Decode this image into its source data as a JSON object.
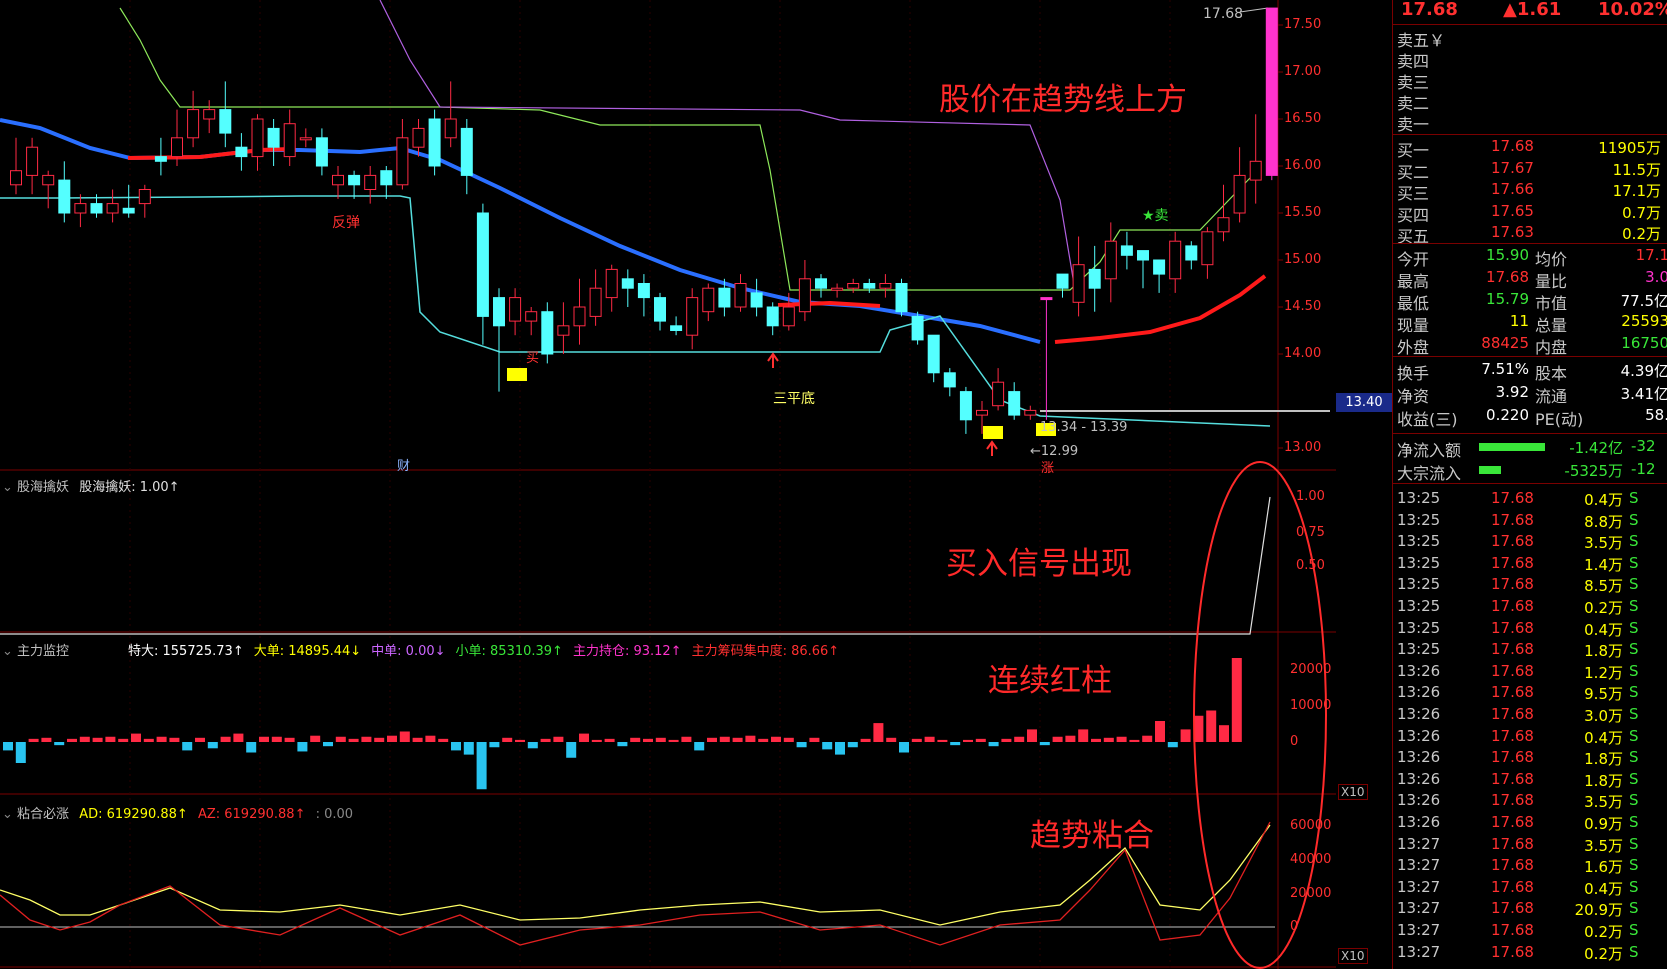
{
  "colors": {
    "up": "#ff2a44",
    "down": "#54ffff",
    "ma_blue": "#2a6fff",
    "ma_red": "#ff1a1a",
    "magenta": "#ff33cc",
    "yellow": "#ffff00",
    "green": "#39e639",
    "grid": "#7a0000"
  },
  "annotations": {
    "above_trend": "股价在趋势线上方",
    "buy_signal": "买入信号出现",
    "red_bars": "连续红柱",
    "trend_merge": "趋势粘合"
  },
  "main_panel": {
    "high_price": "17.68",
    "price_label_40": "13.40",
    "low_price": "←12.99",
    "range_label": "13.34 - 13.39",
    "label_rebound": "反弹",
    "label_three_bottom": "三平底",
    "label_sell": "★卖",
    "label_finance": "财",
    "label_rise": "涨",
    "label_buy": "买",
    "y_ticks": [
      "17.50",
      "17.00",
      "16.50",
      "16.00",
      "15.50",
      "15.00",
      "14.50",
      "14.00",
      "13.00"
    ]
  },
  "panel2": {
    "title": "股海擒妖",
    "formula": "股海擒妖: 1.00↑",
    "y_ticks": [
      "1.00",
      "0.75",
      "0.50"
    ]
  },
  "panel3": {
    "title": "主力监控",
    "items": [
      {
        "label": "特大: 155725.73↑",
        "color": "#ffffff"
      },
      {
        "label": "大单: 14895.44↓",
        "color": "#ffff00"
      },
      {
        "label": "中单: 0.00↓",
        "color": "#cc66ff"
      },
      {
        "label": "小单: 85310.39↑",
        "color": "#39e639"
      },
      {
        "label": "主力持仓: 93.12↑",
        "color": "#ff33cc"
      },
      {
        "label": "主力筹码集中度: 86.66↑",
        "color": "#ff3030"
      }
    ],
    "y_ticks": [
      "20000",
      "10000",
      "0"
    ],
    "unit": "X10"
  },
  "panel4": {
    "title": "粘合必涨",
    "ad": "AD: 619290.88↑",
    "az": "AZ: 619290.88↑",
    "extra": ": 0.00",
    "y_ticks": [
      "60000",
      "40000",
      "20000",
      "0"
    ],
    "unit": "X10"
  },
  "quote": {
    "price": "17.68",
    "change": "▲1.61",
    "pct": "10.02%",
    "sells": [
      "卖五￥",
      "卖四",
      "卖三",
      "卖二",
      "卖一"
    ],
    "buys": [
      {
        "label": "买一",
        "price": "17.68",
        "vol": "11905万"
      },
      {
        "label": "买二",
        "price": "17.67",
        "vol": "11.5万"
      },
      {
        "label": "买三",
        "price": "17.66",
        "vol": "17.1万"
      },
      {
        "label": "买四",
        "price": "17.65",
        "vol": "0.7万"
      },
      {
        "label": "买五",
        "price": "17.63",
        "vol": "0.2万"
      }
    ],
    "stats": [
      {
        "l1": "今开",
        "v1": "15.90",
        "c1": "#39e639",
        "l2": "均价",
        "v2": "17.1",
        "c2": "#ff3030"
      },
      {
        "l1": "最高",
        "v1": "17.68",
        "c1": "#ff3030",
        "l2": "量比",
        "v2": "3.0",
        "c2": "#ff33cc"
      },
      {
        "l1": "最低",
        "v1": "15.79",
        "c1": "#39e639",
        "l2": "市值",
        "v2": "77.5亿",
        "c2": "#ffffff"
      },
      {
        "l1": "现量",
        "v1": "11",
        "c1": "#ffff00",
        "l2": "总量",
        "v2": "25593",
        "c2": "#ffff00"
      },
      {
        "l1": "外盘",
        "v1": "88425",
        "c1": "#ff3030",
        "l2": "内盘",
        "v2": "16750",
        "c2": "#39e639"
      }
    ],
    "stats2": [
      {
        "l1": "换手",
        "v1": "7.51%",
        "l2": "股本",
        "v2": "4.39亿"
      },
      {
        "l1": "净资",
        "v1": "3.92",
        "l2": "流通",
        "v2": "3.41亿"
      },
      {
        "l1": "收益(三)",
        "v1": "0.220",
        "l2": "PE(动)",
        "v2": "58."
      }
    ],
    "flows": [
      {
        "label": "净流入额",
        "val": "-1.42亿",
        "val2": "-32"
      },
      {
        "label": "大宗流入",
        "val": "-5325万",
        "val2": "-12"
      }
    ],
    "ticks": [
      [
        "13:25",
        "17.68",
        "0.4万",
        "S"
      ],
      [
        "13:25",
        "17.68",
        "8.8万",
        "S"
      ],
      [
        "13:25",
        "17.68",
        "3.5万",
        "S"
      ],
      [
        "13:25",
        "17.68",
        "1.4万",
        "S"
      ],
      [
        "13:25",
        "17.68",
        "8.5万",
        "S"
      ],
      [
        "13:25",
        "17.68",
        "0.2万",
        "S"
      ],
      [
        "13:25",
        "17.68",
        "0.4万",
        "S"
      ],
      [
        "13:25",
        "17.68",
        "1.8万",
        "S"
      ],
      [
        "13:26",
        "17.68",
        "1.2万",
        "S"
      ],
      [
        "13:26",
        "17.68",
        "9.5万",
        "S"
      ],
      [
        "13:26",
        "17.68",
        "3.0万",
        "S"
      ],
      [
        "13:26",
        "17.68",
        "0.4万",
        "S"
      ],
      [
        "13:26",
        "17.68",
        "1.8万",
        "S"
      ],
      [
        "13:26",
        "17.68",
        "1.8万",
        "S"
      ],
      [
        "13:26",
        "17.68",
        "3.5万",
        "S"
      ],
      [
        "13:26",
        "17.68",
        "0.9万",
        "S"
      ],
      [
        "13:27",
        "17.68",
        "3.5万",
        "S"
      ],
      [
        "13:27",
        "17.68",
        "1.6万",
        "S"
      ],
      [
        "13:27",
        "17.68",
        "0.4万",
        "S"
      ],
      [
        "13:27",
        "17.68",
        "20.9万",
        "S"
      ],
      [
        "13:27",
        "17.68",
        "0.2万",
        "S"
      ],
      [
        "13:27",
        "17.68",
        "0.2万",
        "S"
      ]
    ]
  }
}
